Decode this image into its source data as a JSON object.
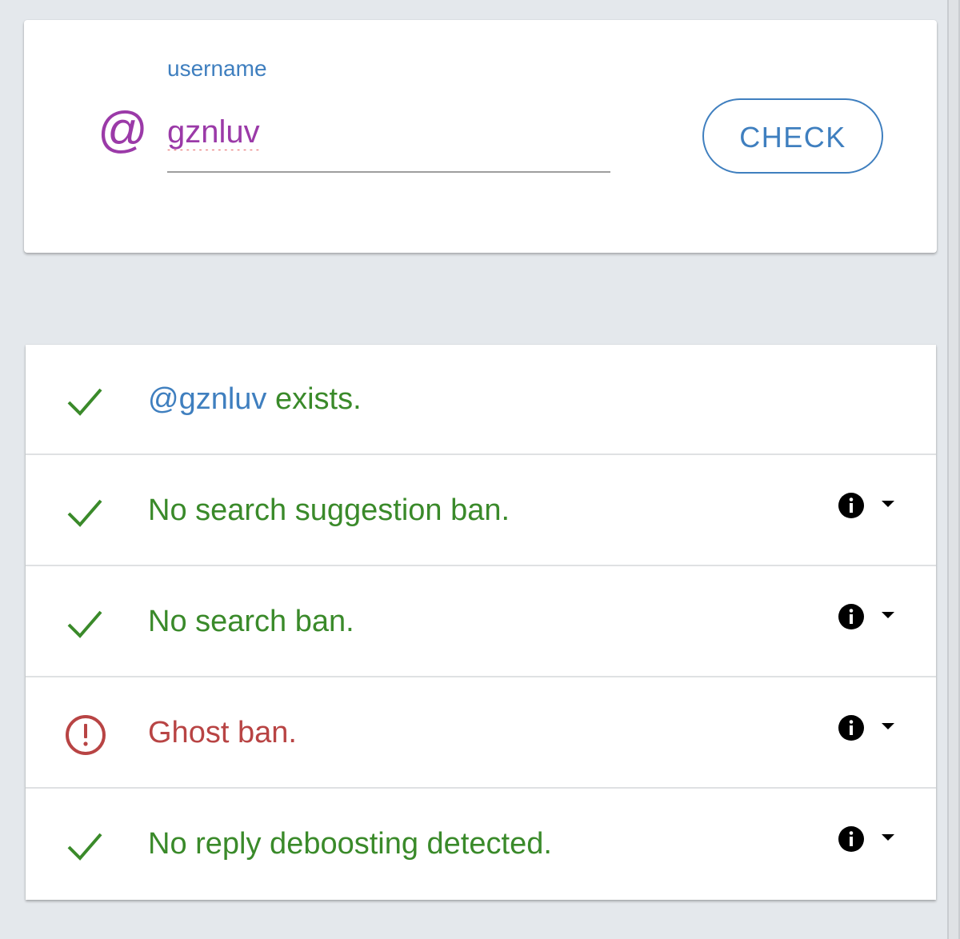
{
  "search": {
    "at_symbol": "@",
    "label": "username",
    "value": "gznluv",
    "button_label": "CHECK"
  },
  "results": [
    {
      "status": "ok",
      "icon": "check-icon",
      "handle": "@gznluv",
      "text": " exists.",
      "has_info": false
    },
    {
      "status": "ok",
      "icon": "check-icon",
      "handle": "",
      "text": "No search suggestion ban.",
      "has_info": true
    },
    {
      "status": "ok",
      "icon": "check-icon",
      "handle": "",
      "text": "No search ban.",
      "has_info": true
    },
    {
      "status": "bad",
      "icon": "alert-circle-icon",
      "handle": "",
      "text": "Ghost ban.",
      "has_info": true
    },
    {
      "status": "ok",
      "icon": "check-icon",
      "handle": "",
      "text": "No reply deboosting detected.",
      "has_info": true
    }
  ],
  "colors": {
    "ok": "#3a8a2a",
    "bad": "#b84444",
    "accent": "#3f7fbf",
    "username": "#9b3aa8",
    "background": "#e4e8ec"
  }
}
